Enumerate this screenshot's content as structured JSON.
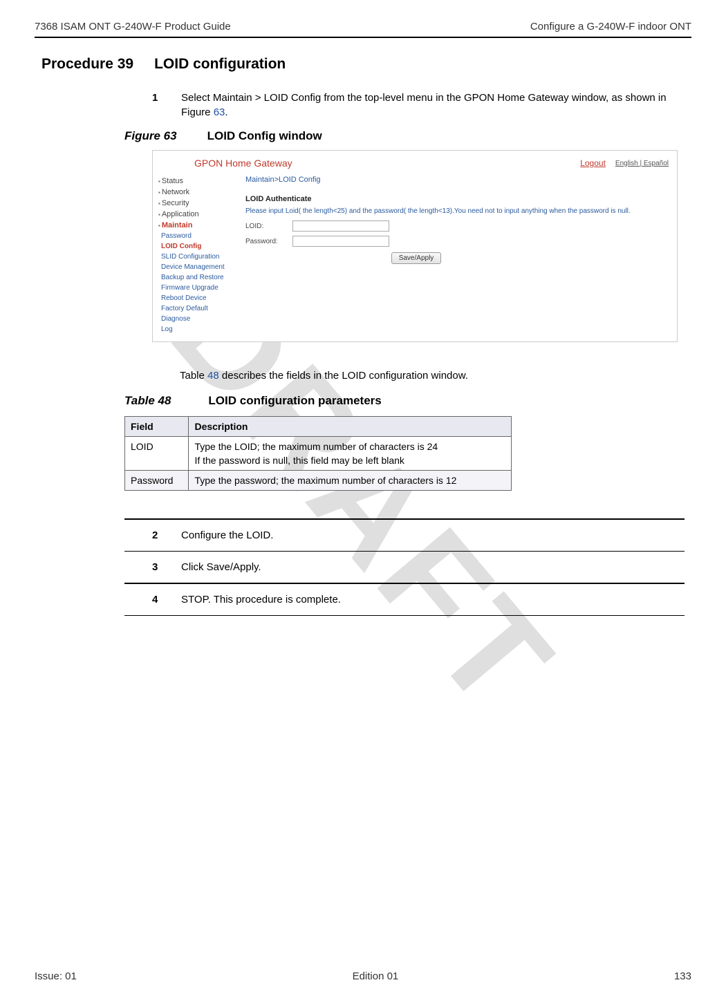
{
  "watermark": "DRAFT",
  "header": {
    "left": "7368 ISAM ONT G-240W-F Product Guide",
    "right": "Configure a G-240W-F indoor ONT"
  },
  "procedure": {
    "label": "Procedure 39",
    "title": "LOID configuration"
  },
  "step1": {
    "num": "1",
    "text_a": "Select Maintain > LOID Config from the top-level menu in the GPON Home Gateway window, as shown in Figure ",
    "link": "63",
    "text_b": "."
  },
  "figure": {
    "label": "Figure 63",
    "caption": "LOID Config window"
  },
  "screenshot": {
    "title": "GPON Home Gateway",
    "logout": "Logout",
    "lang": "English | Español",
    "breadcrumb": "Maintain>LOID Config",
    "nav_top": [
      "Status",
      "Network",
      "Security",
      "Application"
    ],
    "nav_maintain": "Maintain",
    "nav_sub": [
      "Password",
      "LOID Config",
      "SLID Configuration",
      "Device Management",
      "Backup and Restore",
      "Firmware Upgrade",
      "Reboot Device",
      "Factory Default",
      "Diagnose",
      "Log"
    ],
    "section_title": "LOID Authenticate",
    "hint": "Please input Loid( the length<25) and the password( the length<13).You need not to input anything when the password is null.",
    "loid_label": "LOID:",
    "password_label": "Password:",
    "button": "Save/Apply"
  },
  "table_intro_a": "Table ",
  "table_intro_link": "48",
  "table_intro_b": " describes the fields in the LOID configuration window.",
  "table_title": {
    "label": "Table 48",
    "caption": "LOID configuration parameters"
  },
  "table": {
    "headers": [
      "Field",
      "Description"
    ],
    "rows": [
      {
        "field": "LOID",
        "desc": "Type the LOID; the maximum number of characters is 24",
        "desc2": "If the password is null, this field may be left blank"
      },
      {
        "field": "Password",
        "desc": "Type the password; the maximum number of characters is 12"
      }
    ]
  },
  "step2": {
    "num": "2",
    "text": "Configure the LOID."
  },
  "step3": {
    "num": "3",
    "text": "Click Save/Apply."
  },
  "step4": {
    "num": "4",
    "text": "STOP. This procedure is complete."
  },
  "footer": {
    "left": "Issue: 01",
    "center": "Edition 01",
    "right": "133"
  }
}
